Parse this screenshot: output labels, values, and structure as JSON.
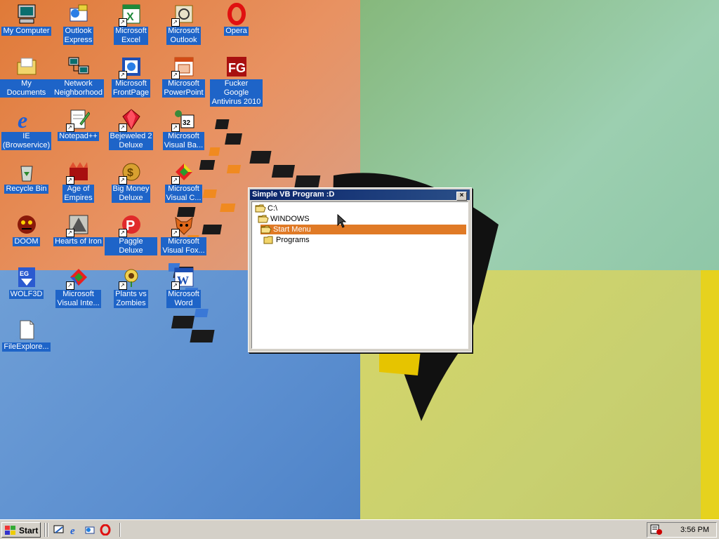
{
  "desktop": {
    "icons": [
      {
        "label": "My Computer",
        "icon": "computer-icon"
      },
      {
        "label": "Outlook\nExpress",
        "icon": "outlook-express-icon"
      },
      {
        "label": "Microsoft\nExcel",
        "icon": "excel-icon"
      },
      {
        "label": "Microsoft\nOutlook",
        "icon": "outlook-icon"
      },
      {
        "label": "Opera",
        "icon": "opera-icon"
      },
      {
        "label": "My Documents",
        "icon": "documents-folder-icon"
      },
      {
        "label": "Network\nNeighborhood",
        "icon": "network-icon"
      },
      {
        "label": "Microsoft\nFrontPage",
        "icon": "frontpage-icon"
      },
      {
        "label": "Microsoft\nPowerPoint",
        "icon": "powerpoint-icon"
      },
      {
        "label": "Fucker Google\nAntivirus 2010",
        "icon": "antivirus-icon"
      },
      {
        "label": "IE\n(Browservice)",
        "icon": "ie-icon"
      },
      {
        "label": "Notepad++",
        "icon": "notepad-icon"
      },
      {
        "label": "Bejeweled 2\nDeluxe",
        "icon": "bejeweled-icon"
      },
      {
        "label": "Microsoft\nVisual Ba...",
        "icon": "visual-basic-icon"
      },
      {
        "label": "Recycle Bin",
        "icon": "recycle-bin-icon"
      },
      {
        "label": "Age of\nEmpires",
        "icon": "age-of-empires-icon"
      },
      {
        "label": "Big Money\nDeluxe",
        "icon": "big-money-icon"
      },
      {
        "label": "Microsoft\nVisual C...",
        "icon": "visual-c-icon"
      },
      {
        "label": "DOOM",
        "icon": "doom-icon"
      },
      {
        "label": "Hearts of Iron",
        "icon": "hearts-of-iron-icon"
      },
      {
        "label": "Paggle Deluxe",
        "icon": "peggle-icon"
      },
      {
        "label": "Microsoft\nVisual Fox...",
        "icon": "visual-fox-icon"
      },
      {
        "label": "WOLF3D",
        "icon": "wolf3d-icon"
      },
      {
        "label": "Microsoft\nVisual Inte...",
        "icon": "visual-interdev-icon"
      },
      {
        "label": "Plants vs\nZombies",
        "icon": "plants-vs-zombies-icon"
      },
      {
        "label": "Microsoft\nWord",
        "icon": "word-icon"
      },
      {
        "label": "FileExplore...",
        "icon": "file-explorer-icon"
      }
    ]
  },
  "window": {
    "title": "Simple VB Program :D",
    "close_label": "×",
    "tree": [
      {
        "label": "C:\\",
        "depth": 0,
        "selected": false,
        "open": true
      },
      {
        "label": "WINDOWS",
        "depth": 1,
        "selected": false,
        "open": true
      },
      {
        "label": "Start Menu",
        "depth": 2,
        "selected": true,
        "open": true
      },
      {
        "label": "Programs",
        "depth": 3,
        "selected": false,
        "open": false
      }
    ]
  },
  "taskbar": {
    "start_label": "Start",
    "quick_launch": [
      "show-desktop-icon",
      "ie-icon",
      "outlook-express-icon",
      "opera-icon"
    ],
    "clock": "3:56 PM"
  },
  "colors": {
    "selection_highlight": "#e07a26",
    "icon_label_bg": "#1e64c8",
    "title_bar": "#0a246a"
  }
}
